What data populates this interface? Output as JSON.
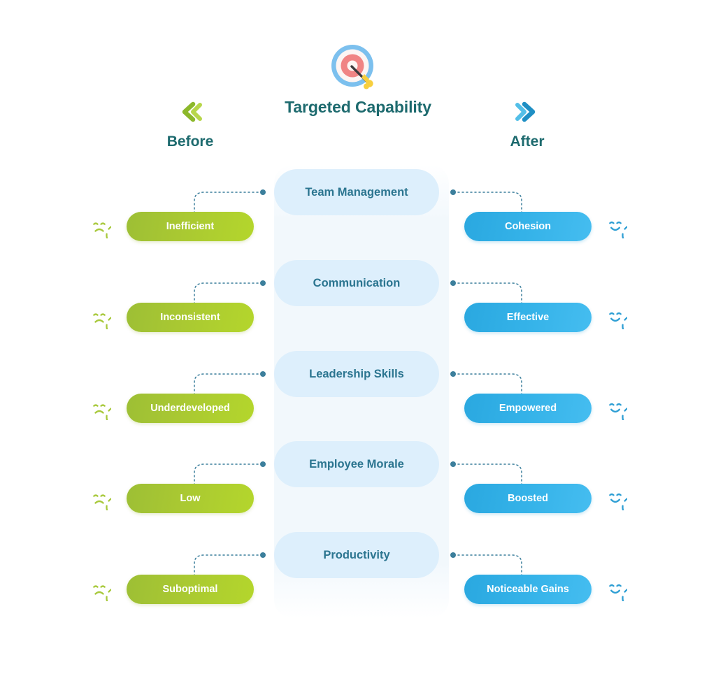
{
  "header": {
    "title": "Targeted Capability",
    "target_icon": "target-bullseye-dart-icon",
    "before": {
      "label": "Before",
      "icon": "double-chevron-left-icon",
      "color": "#8cb82b"
    },
    "after": {
      "label": "After",
      "icon": "double-chevron-right-icon",
      "color": "#2aa0d8"
    }
  },
  "colors": {
    "title": "#1d6a6e",
    "card_bg": "#ddeffc",
    "card_text": "#2b7590",
    "before_pill_from": "#9dbf35",
    "before_pill_to": "#b4d62c",
    "after_pill_from": "#2aa8e0",
    "after_pill_to": "#45bdf0",
    "sad_face": "#a8c93c",
    "happy_face": "#2f9fd4",
    "connector": "#3c7f9c"
  },
  "rows": [
    {
      "capability": "Team Management",
      "before": {
        "label": "Inefficient",
        "icon": "sad-face-icon"
      },
      "after": {
        "label": "Cohesion",
        "icon": "happy-face-icon"
      }
    },
    {
      "capability": "Communication",
      "before": {
        "label": "Inconsistent",
        "icon": "sad-face-icon"
      },
      "after": {
        "label": "Effective",
        "icon": "happy-face-icon"
      }
    },
    {
      "capability": "Leadership Skills",
      "before": {
        "label": "Underdeveloped",
        "icon": "sad-face-icon"
      },
      "after": {
        "label": "Empowered",
        "icon": "happy-face-icon"
      }
    },
    {
      "capability": "Employee Morale",
      "before": {
        "label": "Low",
        "icon": "sad-face-icon"
      },
      "after": {
        "label": "Boosted",
        "icon": "happy-face-icon"
      }
    },
    {
      "capability": "Productivity",
      "before": {
        "label": "Suboptimal",
        "icon": "sad-face-icon"
      },
      "after": {
        "label": "Noticeable Gains",
        "icon": "happy-face-icon"
      }
    }
  ]
}
